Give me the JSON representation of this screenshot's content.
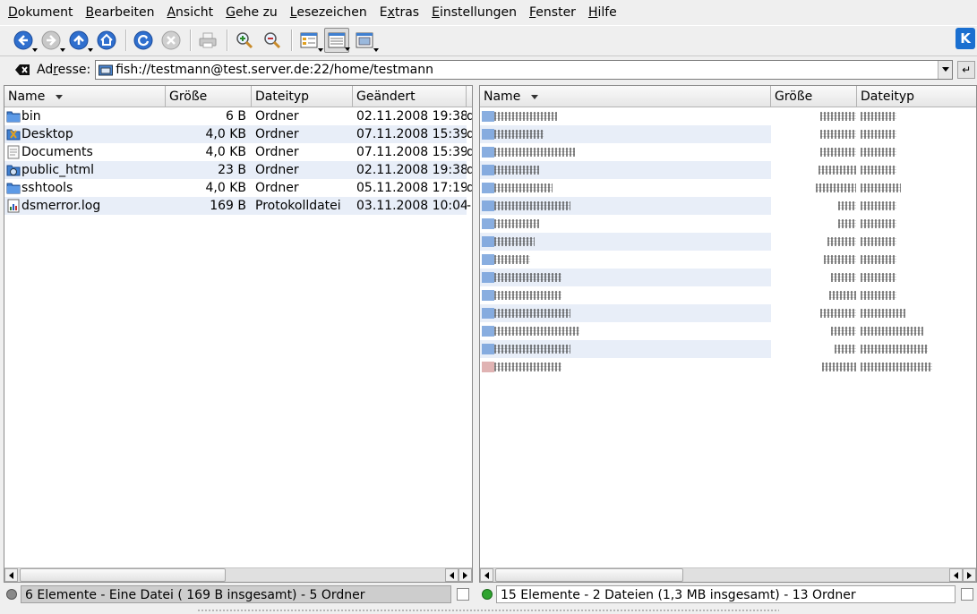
{
  "menu": [
    {
      "mn": "D",
      "rest": "okument"
    },
    {
      "mn": "B",
      "rest": "earbeiten"
    },
    {
      "mn": "A",
      "rest": "nsicht"
    },
    {
      "mn": "G",
      "rest": "ehe zu"
    },
    {
      "mn": "L",
      "rest": "esezeichen"
    },
    {
      "mn": "",
      "pre": "E",
      "mid": "x",
      "rest": "tras"
    },
    {
      "mn": "E",
      "rest": "instellungen"
    },
    {
      "mn": "F",
      "rest": "enster"
    },
    {
      "mn": "H",
      "rest": "ilfe"
    }
  ],
  "address": {
    "label_pre": "Ad",
    "label_mn": "r",
    "label_post": "esse:",
    "value": "fish://testmann@test.server.de:22/home/testmann"
  },
  "left_pane": {
    "columns": [
      "Name",
      "Größe",
      "Dateityp",
      "Geändert"
    ],
    "rows": [
      {
        "icon": "folder-icon",
        "name": "bin",
        "size": "6 B",
        "type": "Ordner",
        "modified": "02.11.2008 19:38",
        "extra": "d"
      },
      {
        "icon": "desktop-folder-icon",
        "name": "Desktop",
        "size": "4,0 KB",
        "type": "Ordner",
        "modified": "07.11.2008 15:39",
        "extra": "d"
      },
      {
        "icon": "documents-folder-icon",
        "name": "Documents",
        "size": "4,0 KB",
        "type": "Ordner",
        "modified": "07.11.2008 15:39",
        "extra": "d"
      },
      {
        "icon": "web-folder-icon",
        "name": "public_html",
        "size": "23 B",
        "type": "Ordner",
        "modified": "02.11.2008 19:38",
        "extra": "d"
      },
      {
        "icon": "folder-icon",
        "name": "sshtools",
        "size": "4,0 KB",
        "type": "Ordner",
        "modified": "05.11.2008 17:19",
        "extra": "d"
      },
      {
        "icon": "log-file-icon",
        "name": "dsmerror.log",
        "size": "169 B",
        "type": "Protokolldatei",
        "modified": "03.11.2008 10:04",
        "extra": "-"
      }
    ],
    "status": "6 Elemente - Eine Datei ( 169 B insgesamt) - 5 Ordner"
  },
  "right_pane": {
    "columns": [
      "Name",
      "Größe",
      "Dateityp"
    ],
    "status": "15 Elemente - 2 Dateien (1,3 MB insgesamt) - 13 Ordner"
  },
  "colors": {
    "folder": "#3f7fd0",
    "led_left": "#8a8a8a",
    "led_right": "#2fa42f",
    "row_alt": "#e8eef8"
  }
}
